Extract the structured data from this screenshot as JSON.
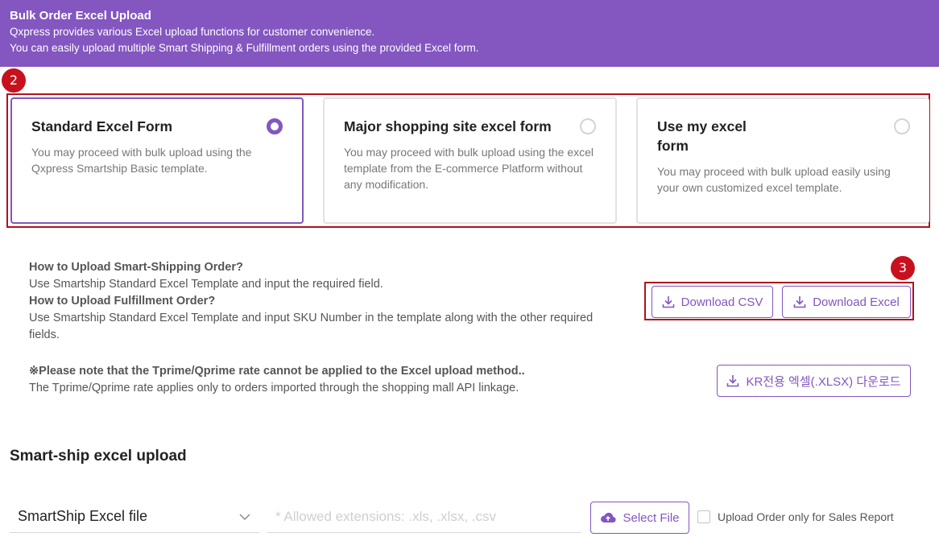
{
  "banner": {
    "title": "Bulk Order Excel Upload",
    "line1": "Qxpress provides various Excel upload functions for customer convenience.",
    "line2": "You can easily upload multiple Smart Shipping & Fulfillment orders using the provided Excel form."
  },
  "markers": {
    "form_options": "2",
    "downloads": "3"
  },
  "forms": [
    {
      "title": "Standard Excel Form",
      "desc": "You may proceed with bulk upload using the Qxpress Smartship Basic template.",
      "selected": true
    },
    {
      "title": "Major shopping site excel form",
      "desc": "You may proceed with bulk upload using the excel template from the E-commerce Platform without any modification.",
      "selected": false
    },
    {
      "title_line1": "Use my excel",
      "title_line2": "form",
      "desc": "You may proceed with bulk upload easily using your own customized excel template.",
      "selected": false
    }
  ],
  "howto": {
    "smart_q": "How to Upload Smart-Shipping Order?",
    "smart_a": "Use Smartship Standard Excel Template and input the required field.",
    "fulfill_q": "How to Upload Fulfillment Order?",
    "fulfill_a": "Use Smartship Standard Excel Template and input SKU Number in the template along with the other required fields."
  },
  "notice": {
    "title": "※Please note that the Tprime/Qprime rate cannot be applied to the Excel upload method..",
    "body": "The Tprime/Qprime rate applies only to orders imported through the shopping mall API linkage."
  },
  "buttons": {
    "download_csv": "Download CSV",
    "download_excel": "Download Excel",
    "kr_download": "KR전용 엑셀(.XLSX) 다운로드",
    "select_file": "Select File"
  },
  "upload": {
    "section_title": "Smart-ship excel upload",
    "file_type": "SmartShip Excel file",
    "extensions_placeholder": "* Allowed extensions: .xls, .xlsx, .csv",
    "sales_report_label": "Upload Order only for Sales Report"
  },
  "colors": {
    "accent": "#8356c0",
    "marker": "#c8111e",
    "annotation_box": "#b0121c"
  },
  "icons": [
    "download-icon",
    "cloud-upload-icon",
    "chevron-down-icon"
  ]
}
